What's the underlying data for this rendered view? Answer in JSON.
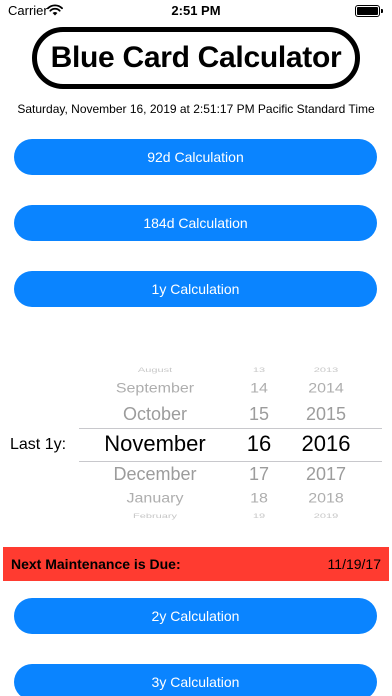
{
  "status_bar": {
    "carrier": "Carrier",
    "time": "2:51 PM",
    "wifi_icon": "wifi-icon",
    "battery_icon": "battery-icon"
  },
  "title": "Blue Card Calculator",
  "date_line": "Saturday, November 16, 2019 at 2:51:17 PM Pacific Standard Time",
  "buttons": {
    "calc_92d": "92d Calculation",
    "calc_184d": "184d Calculation",
    "calc_1y": "1y Calculation",
    "calc_2y": "2y Calculation",
    "calc_3y": "3y Calculation"
  },
  "picker": {
    "label": "Last 1y:",
    "months": [
      "August",
      "September",
      "October",
      "November",
      "December",
      "January",
      "February"
    ],
    "days": [
      "13",
      "14",
      "15",
      "16",
      "17",
      "18",
      "19"
    ],
    "years": [
      "2013",
      "2014",
      "2015",
      "2016",
      "2017",
      "2018",
      "2019"
    ],
    "selected": {
      "month": "November",
      "day": "16",
      "year": "2016"
    }
  },
  "maintenance": {
    "label": "Next Maintenance is Due:",
    "date": "11/19/17"
  },
  "colors": {
    "button_blue": "#0A84FF",
    "due_red": "#FF3B30"
  }
}
